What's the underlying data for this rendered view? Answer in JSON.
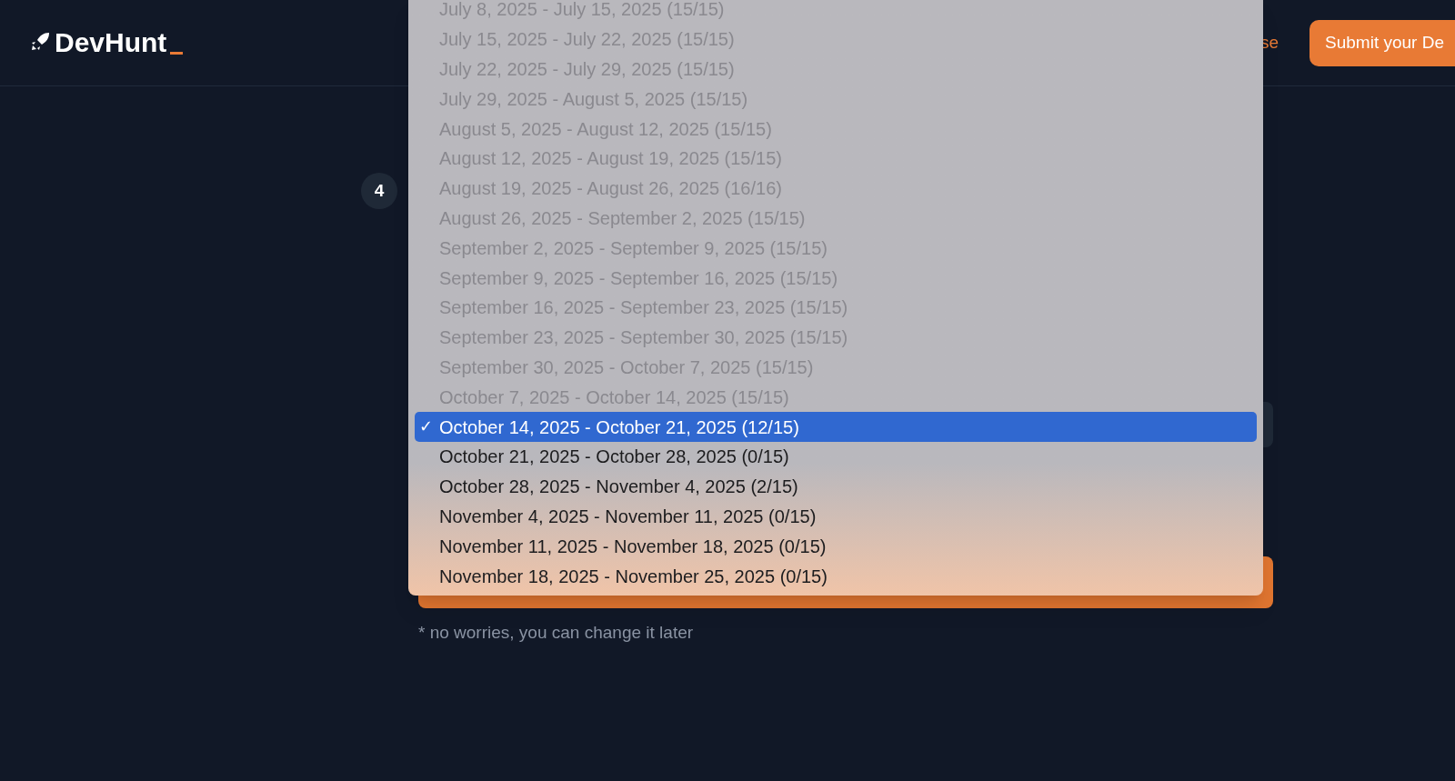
{
  "header": {
    "logo": "DevHunt",
    "nav_link": "se",
    "submit_button": "Submit your De"
  },
  "step": {
    "number": "4"
  },
  "week_dropdown": {
    "check_mark": "✓",
    "options": [
      {
        "label": "July 8, 2025 - July 15, 2025 (15/15)",
        "disabled": true,
        "selected": false
      },
      {
        "label": "July 15, 2025 - July 22, 2025 (15/15)",
        "disabled": true,
        "selected": false
      },
      {
        "label": "July 22, 2025 - July 29, 2025 (15/15)",
        "disabled": true,
        "selected": false
      },
      {
        "label": "July 29, 2025 - August 5, 2025 (15/15)",
        "disabled": true,
        "selected": false
      },
      {
        "label": "August 5, 2025 - August 12, 2025 (15/15)",
        "disabled": true,
        "selected": false
      },
      {
        "label": "August 12, 2025 - August 19, 2025 (15/15)",
        "disabled": true,
        "selected": false
      },
      {
        "label": "August 19, 2025 - August 26, 2025 (16/16)",
        "disabled": true,
        "selected": false
      },
      {
        "label": "August 26, 2025 - September 2, 2025 (15/15)",
        "disabled": true,
        "selected": false
      },
      {
        "label": "September 2, 2025 - September 9, 2025 (15/15)",
        "disabled": true,
        "selected": false
      },
      {
        "label": "September 9, 2025 - September 16, 2025 (15/15)",
        "disabled": true,
        "selected": false
      },
      {
        "label": "September 16, 2025 - September 23, 2025 (15/15)",
        "disabled": true,
        "selected": false
      },
      {
        "label": "September 23, 2025 - September 30, 2025 (15/15)",
        "disabled": true,
        "selected": false
      },
      {
        "label": "September 30, 2025 - October 7, 2025 (15/15)",
        "disabled": true,
        "selected": false
      },
      {
        "label": "October 7, 2025 - October 14, 2025 (15/15)",
        "disabled": true,
        "selected": false
      },
      {
        "label": "October 14, 2025 - October 21, 2025 (12/15)",
        "disabled": false,
        "selected": true
      },
      {
        "label": "October 21, 2025 - October 28, 2025 (0/15)",
        "disabled": false,
        "selected": false
      },
      {
        "label": "October 28, 2025 - November 4, 2025 (2/15)",
        "disabled": false,
        "selected": false
      },
      {
        "label": "November 4, 2025 - November 11, 2025 (0/15)",
        "disabled": false,
        "selected": false
      },
      {
        "label": "November 11, 2025 - November 18, 2025 (0/15)",
        "disabled": false,
        "selected": false
      },
      {
        "label": "November 18, 2025 - November 25, 2025 (0/15)",
        "disabled": false,
        "selected": false
      }
    ]
  },
  "footnote": "* no worries, you can change it later"
}
